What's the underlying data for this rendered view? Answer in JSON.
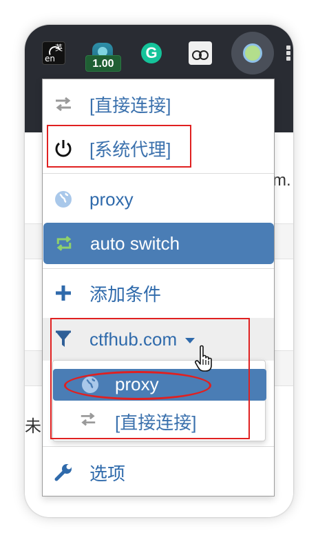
{
  "toolbar": {
    "ime_top": "英",
    "ime_bottom": "en",
    "speed_badge": "1.00",
    "grammarly_letter": "G"
  },
  "page": {
    "fragment_right": "m.",
    "fragment_left": "未"
  },
  "menu": {
    "direct": "[直接连接]",
    "system": "[系统代理]",
    "proxy": "proxy",
    "auto_switch": "auto switch",
    "add_condition": "添加条件",
    "rule_host": "ctfhub.com",
    "options": "选项"
  },
  "submenu": {
    "proxy": "proxy",
    "direct": "[直接连接]"
  },
  "colors": {
    "accent": "#4a7db5",
    "link_text": "#2f6aab",
    "annotation_red": "#e02020",
    "toolbar_bg": "#292c33"
  },
  "icons": {
    "direct": "swap-arrows-icon",
    "system": "power-icon",
    "proxy": "globe-icon",
    "auto_switch": "cycle-arrows-icon",
    "add_condition": "plus-icon",
    "rule": "filter-icon",
    "options": "wrench-icon"
  }
}
